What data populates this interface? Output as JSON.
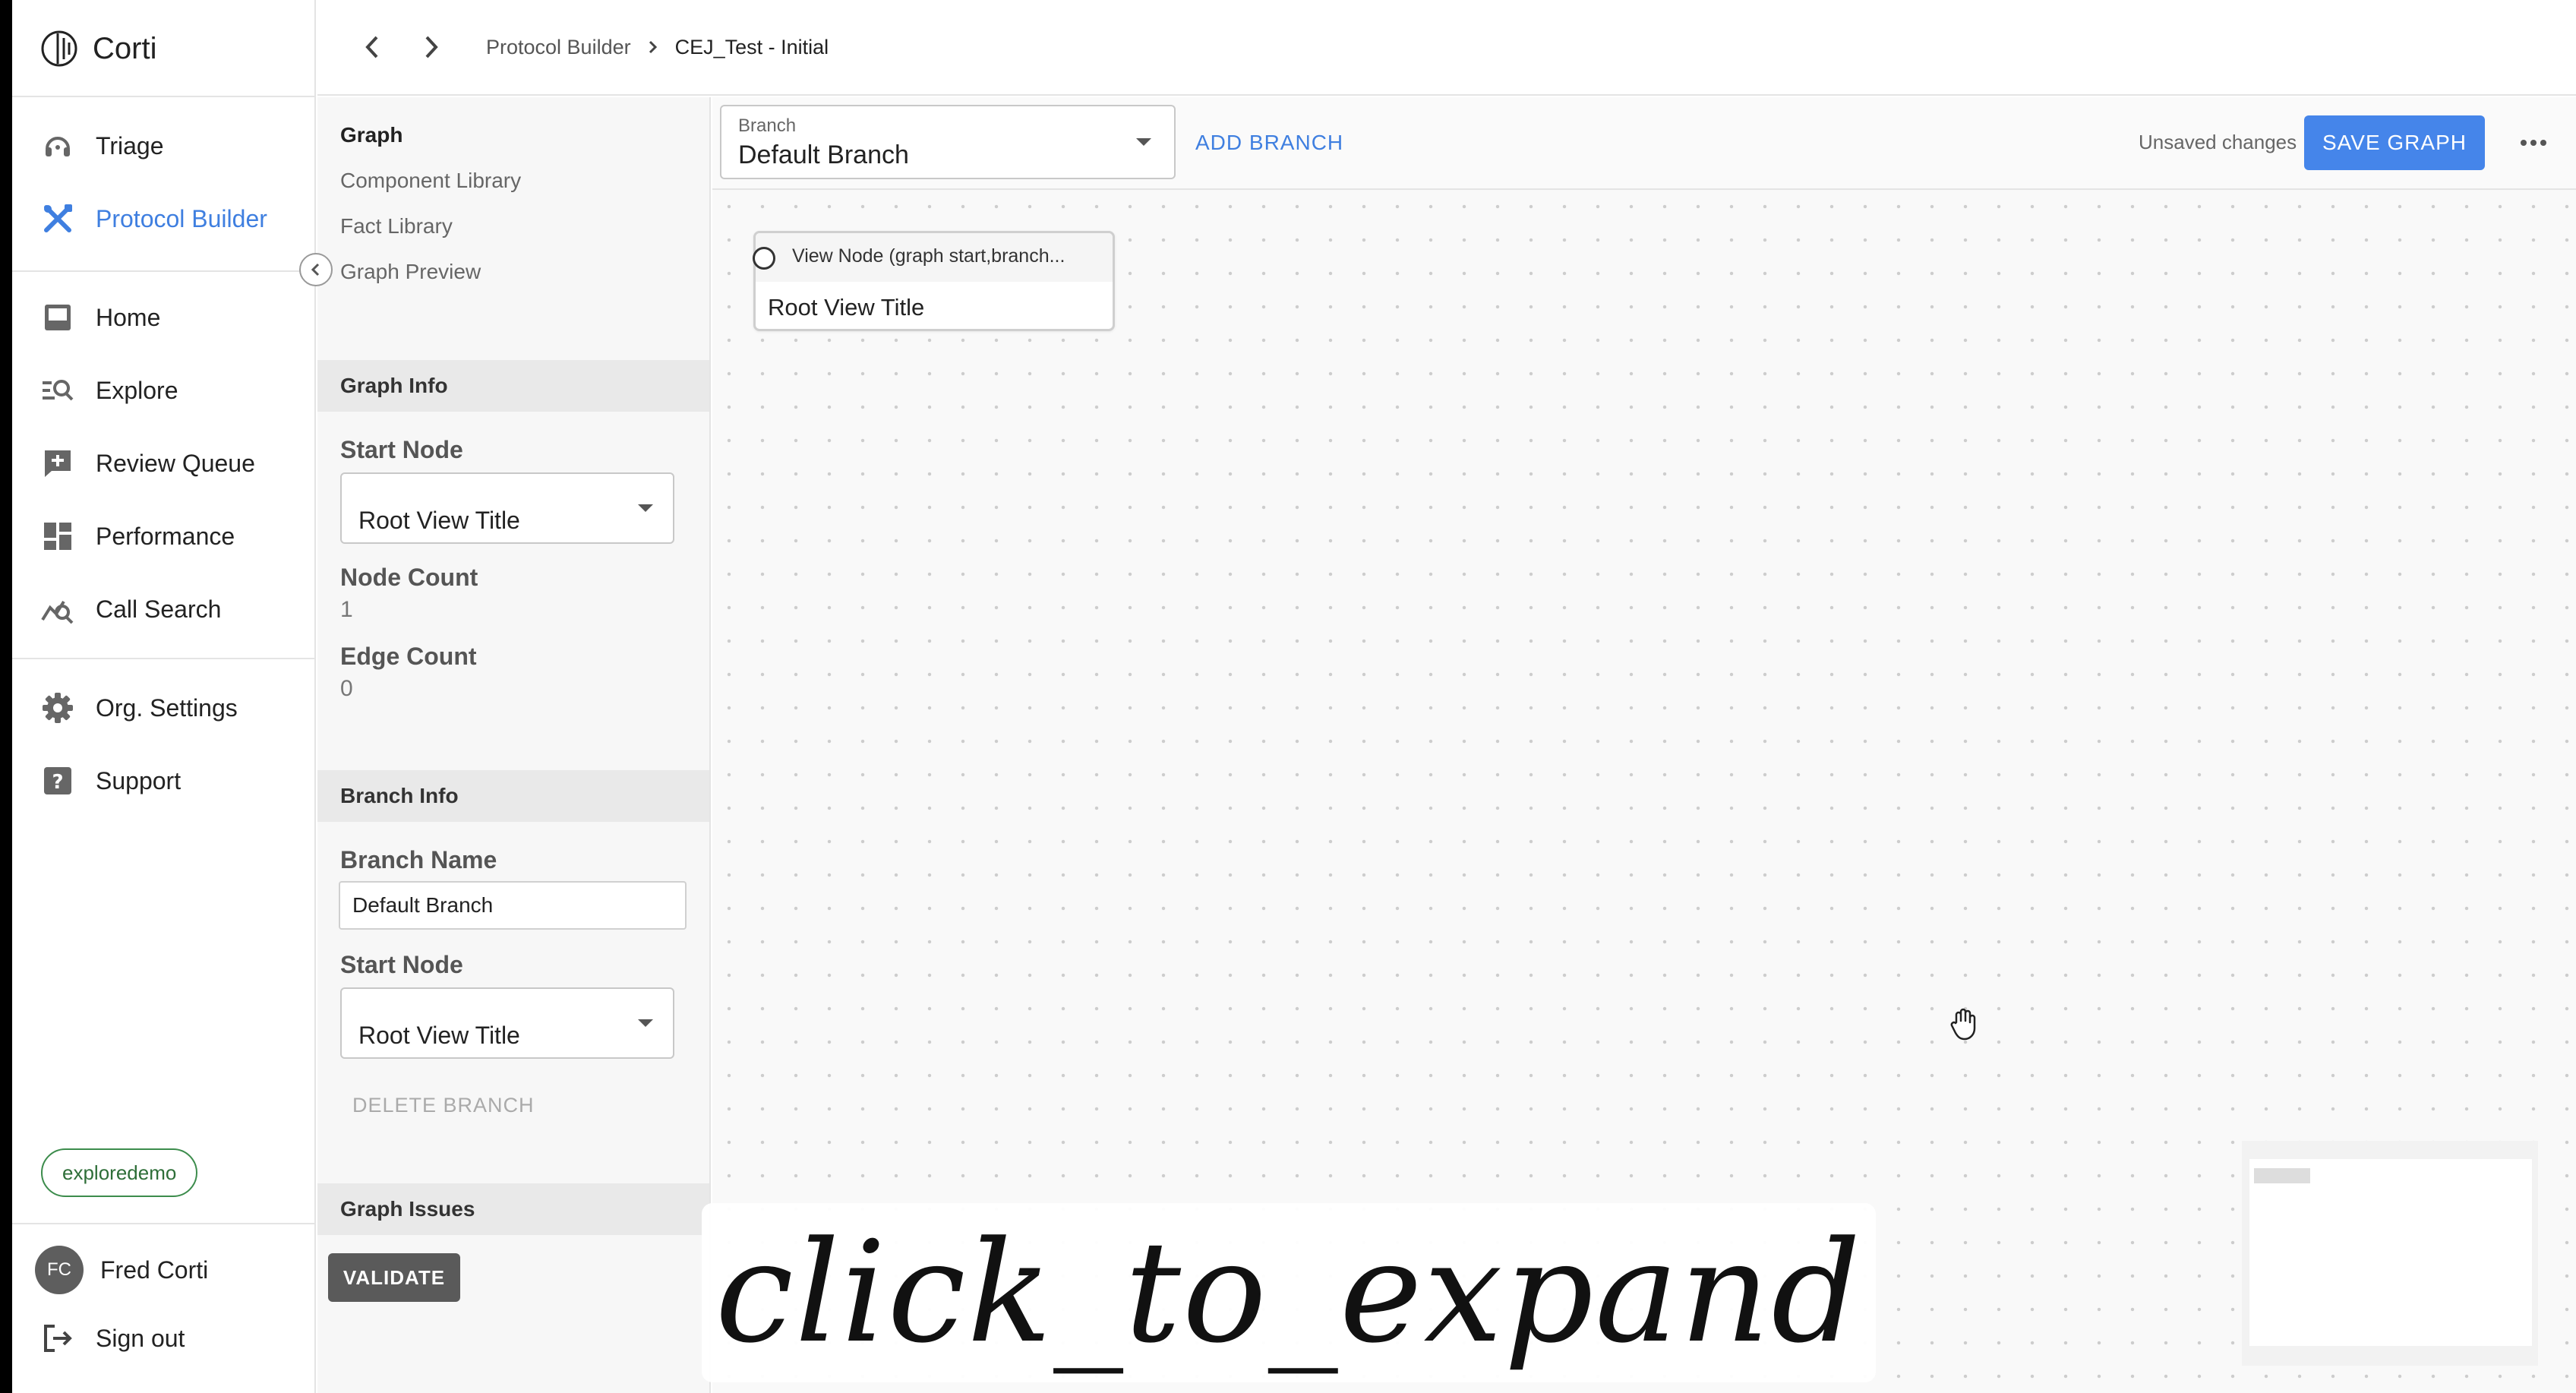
{
  "app": {
    "name": "Corti"
  },
  "nav": {
    "items": [
      {
        "label": "Triage",
        "icon": "headset-icon"
      },
      {
        "label": "Protocol Builder",
        "icon": "tools-icon",
        "active": true
      },
      {
        "label": "Home",
        "icon": "inbox-icon"
      },
      {
        "label": "Explore",
        "icon": "explore-search-icon"
      },
      {
        "label": "Review Queue",
        "icon": "review-queue-icon"
      },
      {
        "label": "Performance",
        "icon": "dashboard-icon"
      },
      {
        "label": "Call Search",
        "icon": "call-search-icon"
      },
      {
        "label": "Org. Settings",
        "icon": "gear-icon"
      },
      {
        "label": "Support",
        "icon": "help-icon"
      }
    ],
    "org": "exploredemo",
    "user": {
      "initials": "FC",
      "name": "Fred Corti"
    },
    "sign_out": "Sign out"
  },
  "breadcrumbs": [
    "Protocol Builder",
    "CEJ_Test - Initial"
  ],
  "panel": {
    "links": [
      "Graph",
      "Component Library",
      "Fact Library",
      "Graph Preview"
    ],
    "graph_info": {
      "header": "Graph Info",
      "start_node_label": "Start Node",
      "start_node_value": "Root View Title",
      "node_count_label": "Node Count",
      "node_count": "1",
      "edge_count_label": "Edge Count",
      "edge_count": "0"
    },
    "branch_info": {
      "header": "Branch Info",
      "branch_name_label": "Branch Name",
      "branch_name_value": "Default Branch",
      "start_node_label": "Start Node",
      "start_node_value": "Root View Title",
      "delete_label": "DELETE BRANCH"
    },
    "graph_issues": {
      "header": "Graph Issues",
      "validate_label": "VALIDATE"
    }
  },
  "toolbar": {
    "branch_label": "Branch",
    "branch_value": "Default Branch",
    "add_branch": "ADD BRANCH",
    "unsaved": "Unsaved changes",
    "save": "SAVE GRAPH"
  },
  "canvas": {
    "node": {
      "header": "View Node (graph start,branch...",
      "title": "Root View Title"
    }
  },
  "overlay": {
    "text": "click_to_expand"
  },
  "colors": {
    "accent": "#4585ea",
    "active_nav": "#3f7fe0",
    "org_chip": "#3c8c4c"
  }
}
